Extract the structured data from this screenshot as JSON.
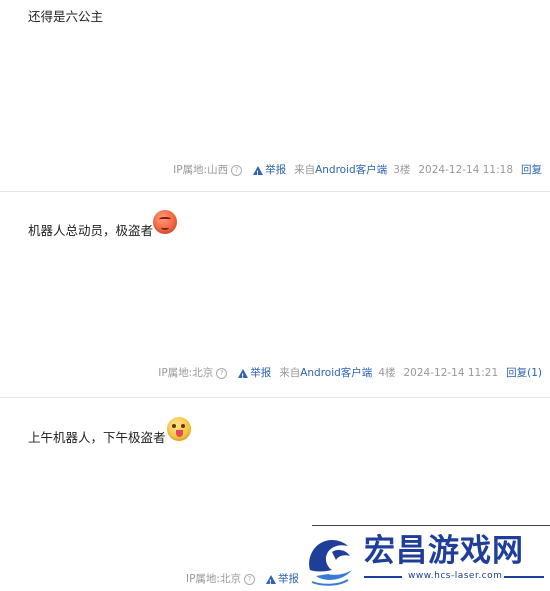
{
  "posts": [
    {
      "content": "还得是六公主",
      "ip": "IP属地:山西",
      "report": "举报",
      "source_prefix": "来自",
      "client": "Android客户端",
      "floor": "3楼",
      "time": "2024-12-14 11:18",
      "reply": "回复"
    },
    {
      "content": "机器人总动员，极盗者",
      "emoji": "angry-face-icon",
      "ip": "IP属地:北京",
      "report": "举报",
      "source_prefix": "来自",
      "client": "Android客户端",
      "floor": "4楼",
      "time": "2024-12-14 11:21",
      "reply": "回复(1)"
    },
    {
      "content": "上午机器人，下午极盗者",
      "emoji": "tongue-out-face-icon",
      "ip": "IP属地:北京",
      "report": "举报"
    }
  ],
  "watermark": {
    "brand": "宏昌游戏网",
    "url": "www.hcs-laser.com",
    "logo_icon": "dragon-wave-icon",
    "color": "#1f3e9a"
  },
  "colors": {
    "link": "#2d64b3",
    "meta": "#999999",
    "divider": "#e7e7e7"
  }
}
